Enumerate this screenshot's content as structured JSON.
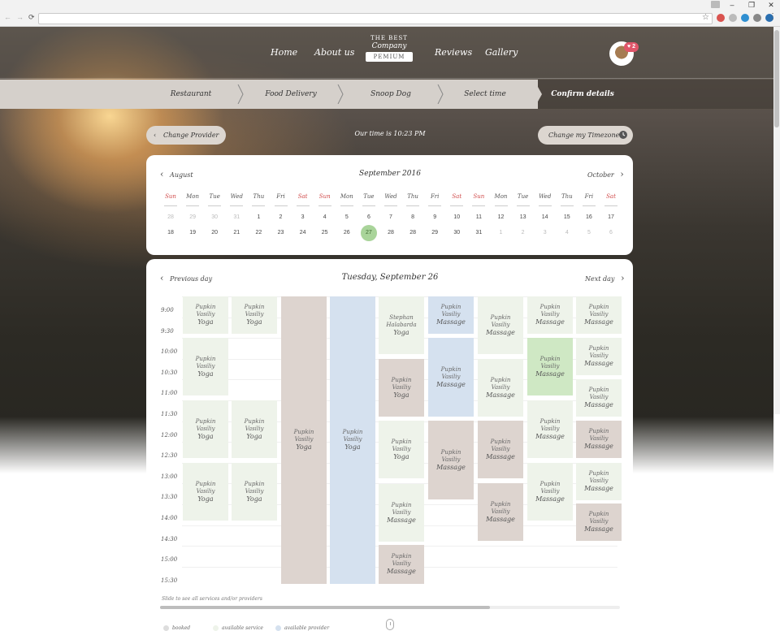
{
  "window": {
    "minimize": "–",
    "maximize": "❐",
    "close": "✕"
  },
  "browser": {
    "back": "←",
    "forward": "→",
    "reload": "⟳",
    "star": "☆",
    "menu": "⋮",
    "url": ""
  },
  "header": {
    "nav": [
      "Home",
      "About us",
      "Reviews",
      "Gallery"
    ],
    "logo": {
      "top": "THE BEST",
      "mid": "Company",
      "ribbon": "PEMIUM"
    },
    "badge": "♥ 2"
  },
  "steps": [
    "Restaurant",
    "Food Delivery",
    "Snoop Dog",
    "Select time",
    "Confirm details"
  ],
  "controls": {
    "change_provider": "Change Provider",
    "our_time": "Our time is 10:23 PM",
    "change_timezone": "Change my Timezone"
  },
  "calendar": {
    "prev": "August",
    "title": "September 2016",
    "next": "October",
    "weekdays": [
      "Sun",
      "Mon",
      "Tue",
      "Wed",
      "Thu",
      "Fri",
      "Sat",
      "Sun",
      "Mon",
      "Tue",
      "Wed",
      "Thu",
      "Fri",
      "Sat",
      "Sun",
      "Mon",
      "Tue",
      "Wed",
      "Thu",
      "Fri",
      "Sat"
    ],
    "row1": [
      "28",
      "29",
      "30",
      "31",
      "1",
      "2",
      "3",
      "4",
      "5",
      "6",
      "7",
      "8",
      "9",
      "10",
      "11",
      "12",
      "13",
      "14",
      "15",
      "16",
      "17"
    ],
    "row2": [
      "18",
      "19",
      "20",
      "21",
      "22",
      "23",
      "24",
      "25",
      "26",
      "27",
      "28",
      "28",
      "29",
      "30",
      "31",
      "1",
      "2",
      "3",
      "4",
      "5",
      "6"
    ],
    "selected": "27"
  },
  "schedule": {
    "prev": "Previous day",
    "title": "Tuesday, September 26",
    "next": "Next day",
    "times": [
      "9:00",
      "9:30",
      "10:00",
      "10:30",
      "11:00",
      "11:30",
      "12:00",
      "12:30",
      "13:00",
      "13:30",
      "14:00",
      "14:30",
      "15:00",
      "15:30"
    ],
    "slots": [
      {
        "l1": "Pupkin",
        "l2": "Vasiliy",
        "svc": "Yoga",
        "c": "green"
      },
      {
        "l1": "Pupkin",
        "l2": "Vasiliy",
        "svc": "Yoga",
        "c": "green"
      },
      {
        "l1": "Pupkin",
        "l2": "Vasiliy",
        "svc": "Yoga",
        "c": "green"
      },
      {
        "l1": "Pupkin",
        "l2": "Vasiliy",
        "svc": "Yoga",
        "c": "green"
      },
      {
        "l1": "Pupkin",
        "l2": "Vasiliy",
        "svc": "Yoga",
        "c": "green"
      },
      {
        "l1": "Pupkin",
        "l2": "Vasiliy",
        "svc": "Yoga",
        "c": "green"
      },
      {
        "l1": "Pupkin",
        "l2": "Vasiliy",
        "svc": "Yoga",
        "c": "green"
      },
      {
        "l1": "Pupkin",
        "l2": "Vasiliy",
        "svc": "Yoga",
        "c": "gray"
      },
      {
        "l1": "Pupkin",
        "l2": "Vasiliy",
        "svc": "Yoga",
        "c": "blue"
      },
      {
        "l1": "Stephan",
        "l2": "Halabarda",
        "svc": "Yoga",
        "c": "green"
      },
      {
        "l1": "Pupkin",
        "l2": "Vasiliy",
        "svc": "Yoga",
        "c": "gray"
      },
      {
        "l1": "Pupkin",
        "l2": "Vasiliy",
        "svc": "Yoga",
        "c": "green"
      },
      {
        "l1": "Pupkin",
        "l2": "Vasiliy",
        "svc": "Massage",
        "c": "green"
      },
      {
        "l1": "Pupkin",
        "l2": "Vasiliy",
        "svc": "Massage",
        "c": "gray"
      },
      {
        "l1": "Pupkin",
        "l2": "Vasiliy",
        "svc": "Massage",
        "c": "blue"
      },
      {
        "l1": "Pupkin",
        "l2": "Vasiliy",
        "svc": "Massage",
        "c": "blue"
      },
      {
        "l1": "Pupkin",
        "l2": "Vasiliy",
        "svc": "Massage",
        "c": "gray"
      },
      {
        "l1": "Pupkin",
        "l2": "Vasiliy",
        "svc": "Massage",
        "c": "green"
      },
      {
        "l1": "Pupkin",
        "l2": "Vasiliy",
        "svc": "Massage",
        "c": "green"
      },
      {
        "l1": "Pupkin",
        "l2": "Vasiliy",
        "svc": "Massage",
        "c": "gray"
      },
      {
        "l1": "Pupkin",
        "l2": "Vasiliy",
        "svc": "Massage",
        "c": "gray"
      },
      {
        "l1": "Pupkin",
        "l2": "Vasiliy",
        "svc": "Massage",
        "c": "green"
      },
      {
        "l1": "Pupkin",
        "l2": "Vasiliy",
        "svc": "Massage",
        "c": "bright"
      },
      {
        "l1": "Pupkin",
        "l2": "Vasiliy",
        "svc": "Massage",
        "c": "green"
      },
      {
        "l1": "Pupkin",
        "l2": "Vasiliy",
        "svc": "Massage",
        "c": "green"
      },
      {
        "l1": "Pupkin",
        "l2": "Vasiliy",
        "svc": "Massage",
        "c": "green"
      },
      {
        "l1": "Pupkin",
        "l2": "Vasiliy",
        "svc": "Massage",
        "c": "green"
      },
      {
        "l1": "Pupkin",
        "l2": "Vasiliy",
        "svc": "Massage",
        "c": "green"
      },
      {
        "l1": "Pupkin",
        "l2": "Vasiliy",
        "svc": "Massage",
        "c": "gray"
      },
      {
        "l1": "Pupkin",
        "l2": "Vasiliy",
        "svc": "Massage",
        "c": "green"
      },
      {
        "l1": "Pupkin",
        "l2": "Vasiliy",
        "svc": "Massage",
        "c": "gray"
      }
    ],
    "hint": "Slide to see all services and/or providers",
    "legend": [
      "booked",
      "available service",
      "available provider"
    ]
  },
  "colors": {
    "slot_green": "#eef3ea",
    "slot_gray": "#ddd4cf",
    "slot_blue": "#d5e1ef",
    "slot_bright": "#cfe8c4",
    "selected_day": "#a9d49a",
    "weekend_red": "#d04a4a"
  }
}
